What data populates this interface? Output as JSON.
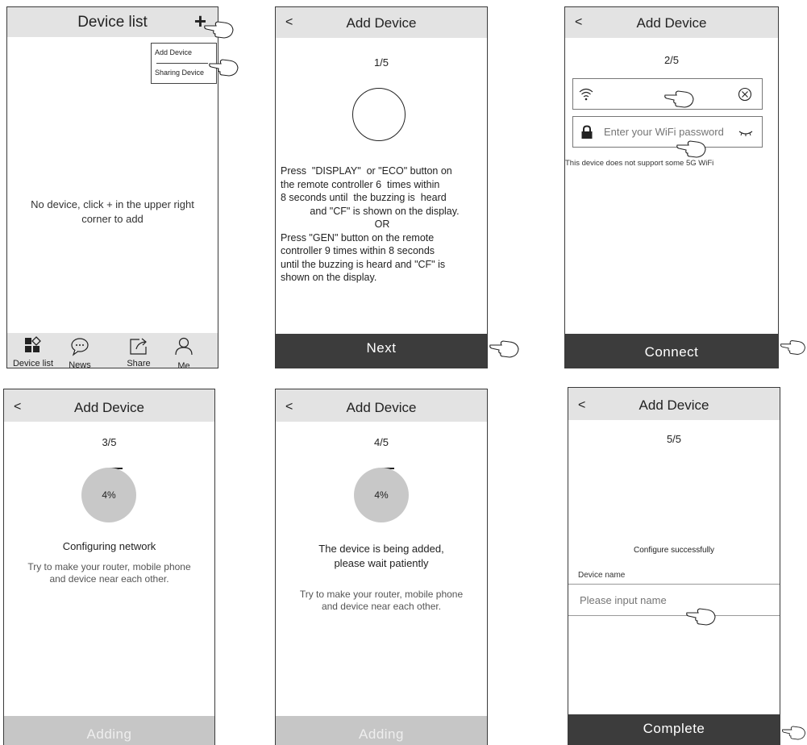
{
  "screen1": {
    "title": "Device list",
    "plus_symbol": "+",
    "menu": [
      "Add Device",
      "Sharing Device"
    ],
    "empty_message": "No device, click + in the upper right corner to add",
    "tabs": [
      {
        "label": "Device list",
        "icon": "device-list-icon"
      },
      {
        "label": "News",
        "icon": "news-icon"
      },
      {
        "label": "Share",
        "icon": "share-icon"
      },
      {
        "label": "Me",
        "icon": "me-icon"
      }
    ]
  },
  "screen2": {
    "back": "<",
    "title": "Add Device",
    "step": "1/5",
    "instructions": [
      "Press  \"DISPLAY\"  or \"ECO\" button on",
      "the remote controller 6  times within",
      "8 seconds until  the buzzing is  heard",
      "and \"CF\" is shown on the display.",
      "OR",
      "Press \"GEN\" button on the remote",
      "controller 9 times within 8 seconds",
      "until the buzzing is heard and \"CF\" is",
      "shown on the display."
    ],
    "button": "Next"
  },
  "screen3": {
    "back": "<",
    "title": "Add Device",
    "step": "2/5",
    "password_placeholder": "Enter your WiFi password",
    "note": "This device does not support some 5G WiFi",
    "button": "Connect"
  },
  "screen4": {
    "back": "<",
    "title": "Add Device",
    "step": "3/5",
    "progress": "4%",
    "status": "Configuring network",
    "hint_lines": [
      "Try to make your router, mobile phone",
      "and device near each other."
    ],
    "button": "Adding"
  },
  "screen5": {
    "back": "<",
    "title": "Add Device",
    "step": "4/5",
    "progress": "4%",
    "status_lines": [
      "The device is being added,",
      "please wait patiently"
    ],
    "hint_lines": [
      "Try to make your router, mobile phone",
      "and device near each other."
    ],
    "button": "Adding"
  },
  "screen6": {
    "back": "<",
    "title": "Add Device",
    "step": "5/5",
    "status": "Configure successfully",
    "name_label": "Device name",
    "name_placeholder": "Please input name",
    "button": "Complete"
  },
  "colors": {
    "header_bg": "#e3e3e3",
    "dark_button": "#3c3c3c",
    "grey_button": "#c6c6c6",
    "progress": "#c8c8c8"
  }
}
